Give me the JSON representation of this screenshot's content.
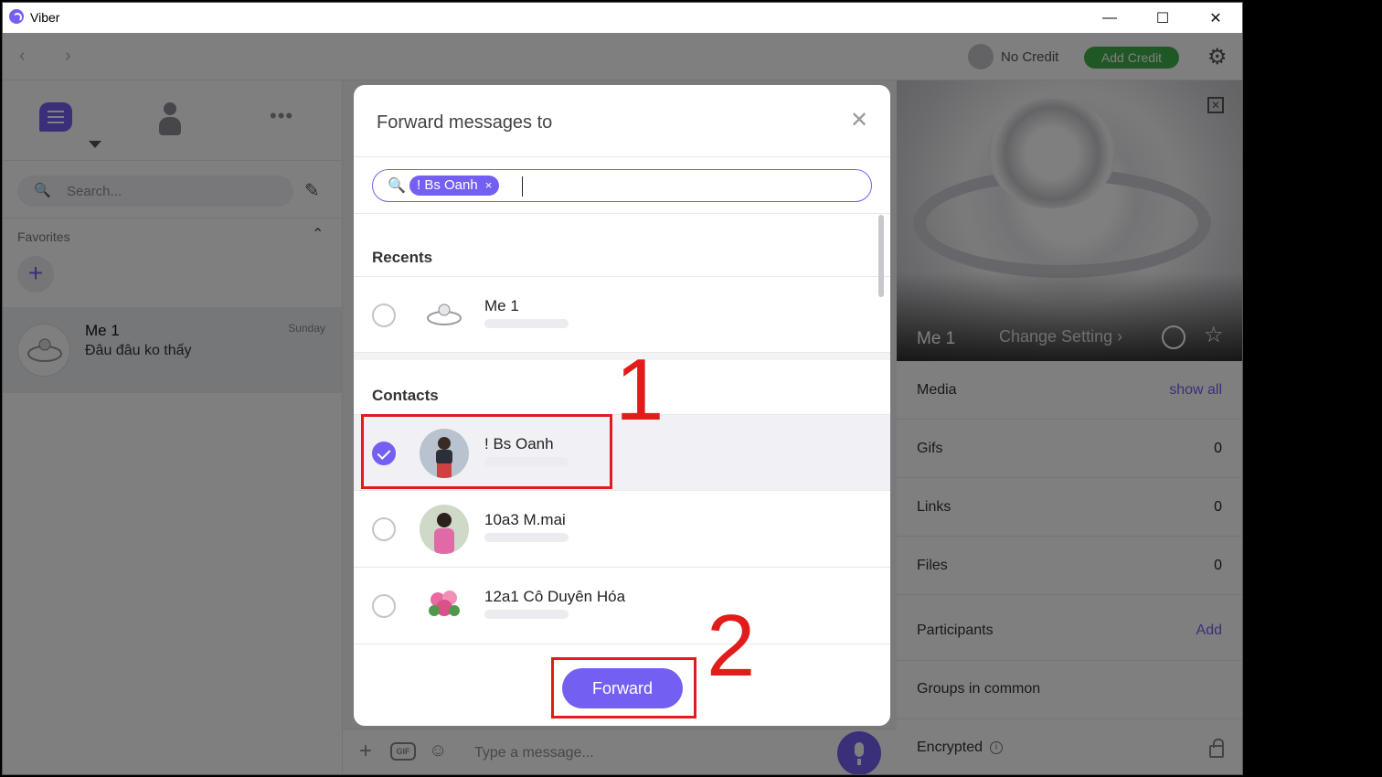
{
  "window": {
    "title": "Viber",
    "controls": {
      "minimize": "—",
      "maximize": "☐",
      "close": "✕"
    }
  },
  "topbar": {
    "back_icon": "‹",
    "forward_icon": "›",
    "no_credit": "No Credit",
    "add_credit": "Add Credit",
    "settings_icon": "⚙"
  },
  "sidebar": {
    "more_icon": "•••",
    "search_icon": "🔍",
    "search_placeholder": "Search...",
    "compose_icon": "✎",
    "favorites_label": "Favorites",
    "favorites_toggle": "⌃",
    "favorites_add": "+",
    "chats": [
      {
        "name": "Me 1",
        "last_message": "Đâu đâu ko thấy",
        "time": "Sunday"
      }
    ]
  },
  "composer": {
    "plus": "+",
    "gif": "GIF",
    "sticker": "☺",
    "placeholder": "Type a message..."
  },
  "info_panel": {
    "close_icon": "✕",
    "name": "Me 1",
    "setting": "Change Setting ›",
    "star_icon": "☆",
    "rows": [
      {
        "label": "Media",
        "link": "show all"
      },
      {
        "label": "Gifs",
        "value": "0"
      },
      {
        "label": "Links",
        "value": "0"
      },
      {
        "label": "Files",
        "value": "0"
      },
      {
        "label": "Participants",
        "link": "Add"
      },
      {
        "label": "Groups in common"
      },
      {
        "label": "Encrypted",
        "info_icon": "i"
      }
    ]
  },
  "dialog": {
    "title": "Forward messages to",
    "close_icon": "✕",
    "search_icon": "🔍",
    "chip_label": "! Bs Oanh",
    "chip_remove": "×",
    "recents_heading": "Recents",
    "recents": [
      {
        "name": "Me 1",
        "selected": false
      }
    ],
    "contacts_heading": "Contacts",
    "contacts": [
      {
        "name": "! Bs Oanh",
        "selected": true
      },
      {
        "name": "10a3 M.mai",
        "selected": false
      },
      {
        "name": "12a1 Cô Duyên Hóa",
        "selected": false
      }
    ],
    "forward_button": "Forward"
  },
  "annotations": {
    "step1": "1",
    "step2": "2"
  },
  "colors": {
    "accent": "#7360f2",
    "credit_green": "#41b04b",
    "annotation_red": "#e21b1b"
  }
}
